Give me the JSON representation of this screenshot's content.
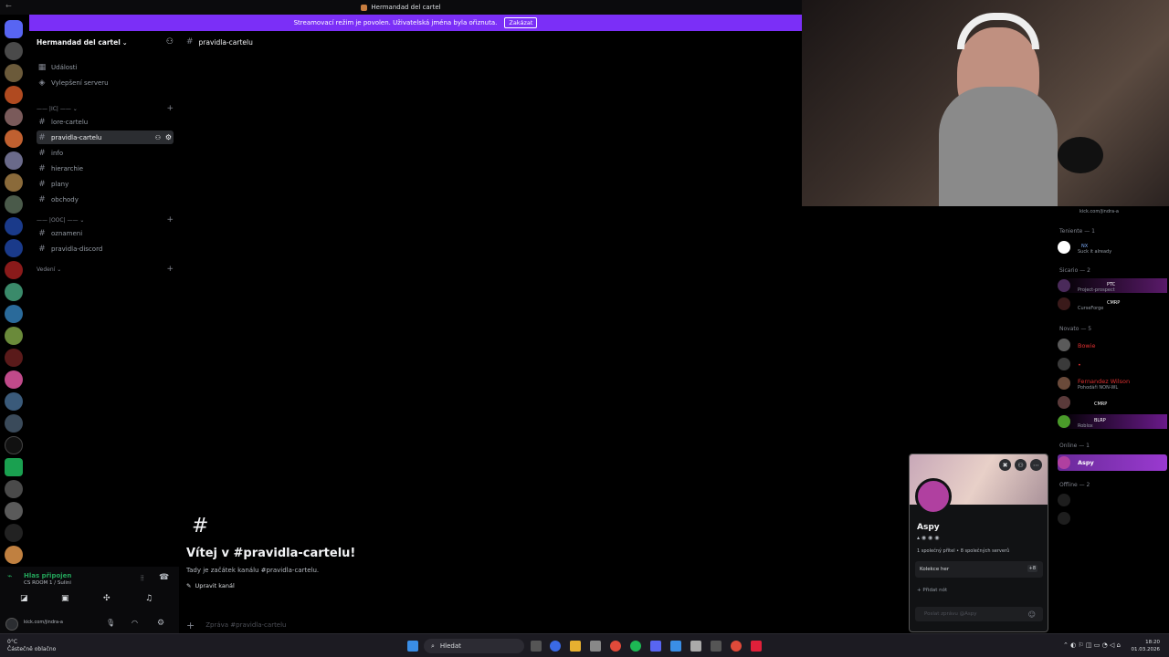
{
  "window": {
    "title": "Hermandad del cartel"
  },
  "banner": {
    "text": "Streamovací režim je povolen. Uživatelská jména byla ořiznuta.",
    "button": "Zakázat"
  },
  "sidebar": {
    "server_name": "Hermandad del cartel",
    "top_items": [
      {
        "label": "Události"
      },
      {
        "label": "Vylepšení serveru"
      }
    ],
    "categories": [
      {
        "label": "IC"
      },
      {
        "label": "OOC"
      },
      {
        "label": "Vedení"
      }
    ],
    "channels": [
      {
        "label": "lore-cartelu"
      },
      {
        "label": "pravidla-cartelu"
      },
      {
        "label": "info"
      },
      {
        "label": "hierarchie"
      },
      {
        "label": "plany"
      },
      {
        "label": "obchody"
      },
      {
        "label": "oznameni"
      },
      {
        "label": "pravidla-discord"
      }
    ]
  },
  "voice": {
    "status": "Hlas připojen",
    "room": "CS ROOM 1 / Sulini"
  },
  "user": {
    "status_text": "kick.com/jindra-a"
  },
  "main": {
    "header_channel": "pravidla-cartelu",
    "welcome_title": "Vítej v #pravidla-cartelu!",
    "welcome_sub": "Tady je začátek kanálu #pravidla-cartelu.",
    "edit_button": "Upravit kanál",
    "composer_placeholder": "Zpráva #pravidla-cartelu"
  },
  "members": {
    "top_sub": "kick.com/jindra-a",
    "groups": [
      {
        "label": "Teniente — 1"
      },
      {
        "label": "Sicario — 2"
      },
      {
        "label": "Novato — 5"
      },
      {
        "label": "Online — 1"
      },
      {
        "label": "Offline — 2"
      }
    ],
    "entries": [
      {
        "name": "",
        "sub": "Suck it already",
        "tag": "NX"
      },
      {
        "name": "",
        "sub": "Project-prospect",
        "tag": "PTC"
      },
      {
        "name": "",
        "sub": "CurseForge",
        "tag": "CMRP"
      },
      {
        "name": "Bowie",
        "sub": "",
        "tag": ""
      },
      {
        "name": "Fernandez Wilson",
        "sub": "Pohodáři NON-WL",
        "tag": ""
      },
      {
        "name": "",
        "sub": "",
        "tag": "CMRP"
      },
      {
        "name": "",
        "sub": "Roblox",
        "tag": "BLRP"
      },
      {
        "name": "Aspy",
        "sub": "",
        "tag": ""
      }
    ]
  },
  "popup": {
    "name": "Aspy",
    "mutual": "1 společný přítel • 8 společných serverů",
    "games_label": "Kolekce her",
    "games_more": "+8",
    "add_note": "Přidat nót",
    "message_placeholder": "Poslat zprávu @Aspy"
  },
  "taskbar": {
    "weather_temp": "0°C",
    "weather_desc": "Částečně oblačno",
    "search_label": "Hledat",
    "time": "18:20",
    "date": "01.03.2026"
  }
}
